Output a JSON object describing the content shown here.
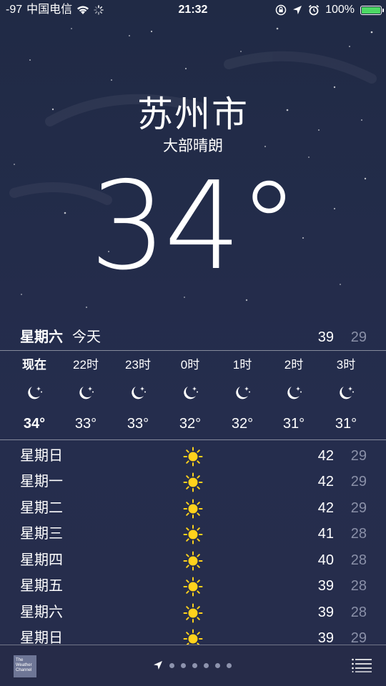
{
  "status": {
    "signal": "-97",
    "carrier": "中国电信",
    "time": "21:32",
    "battery": "100%",
    "battery_color": "#4cd964"
  },
  "header": {
    "city": "苏州市",
    "condition": "大部晴朗",
    "temperature": "34°"
  },
  "today": {
    "day": "星期六",
    "label": "今天",
    "high": "39",
    "low": "29"
  },
  "hourly": [
    {
      "time": "现在",
      "icon": "moon-stars-icon",
      "temp": "34°"
    },
    {
      "time": "22时",
      "icon": "moon-stars-icon",
      "temp": "33°"
    },
    {
      "time": "23时",
      "icon": "moon-stars-icon",
      "temp": "33°"
    },
    {
      "time": "0时",
      "icon": "moon-stars-icon",
      "temp": "32°"
    },
    {
      "time": "1时",
      "icon": "moon-stars-icon",
      "temp": "32°"
    },
    {
      "time": "2时",
      "icon": "moon-stars-icon",
      "temp": "31°"
    },
    {
      "time": "3时",
      "icon": "moon-stars-icon",
      "temp": "31°"
    }
  ],
  "daily": [
    {
      "day": "星期日",
      "icon": "sun-icon",
      "high": "42",
      "low": "29"
    },
    {
      "day": "星期一",
      "icon": "sun-icon",
      "high": "42",
      "low": "29"
    },
    {
      "day": "星期二",
      "icon": "sun-icon",
      "high": "42",
      "low": "29"
    },
    {
      "day": "星期三",
      "icon": "sun-icon",
      "high": "41",
      "low": "28"
    },
    {
      "day": "星期四",
      "icon": "sun-icon",
      "high": "40",
      "low": "28"
    },
    {
      "day": "星期五",
      "icon": "sun-icon",
      "high": "39",
      "low": "28"
    },
    {
      "day": "星期六",
      "icon": "sun-icon",
      "high": "39",
      "low": "28"
    },
    {
      "day": "星期日",
      "icon": "sun-icon",
      "high": "39",
      "low": "29"
    }
  ],
  "bottom": {
    "logo_text": "The Weather Channel",
    "page_count": 6,
    "current_page_is_location": true
  },
  "colors": {
    "sun": "#ffd21c",
    "low_temp": "#8a90a8"
  }
}
